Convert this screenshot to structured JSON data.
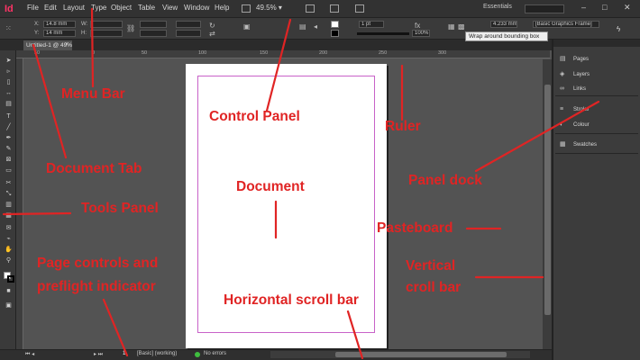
{
  "app": {
    "logo": "Id"
  },
  "menu": [
    "File",
    "Edit",
    "Layout",
    "Type",
    "Object",
    "Table",
    "View",
    "Window",
    "Help"
  ],
  "zoom": "49.5%",
  "workspace": "Essentials",
  "control_panel": {
    "x_label": "X:",
    "x_value": "14.8 mm",
    "y_label": "Y:",
    "y_value": "14 mm",
    "w_label": "W:",
    "h_label": "H:",
    "stroke_weight": "1 pt",
    "scale_value": "100%",
    "offset_value": "4.233 mm",
    "frame_style": "[Basic Graphics Frame]",
    "tooltip": "Wrap around bounding box"
  },
  "document_tab": {
    "label": "Untitled-1 @ 49%",
    "close": "×"
  },
  "ruler_ticks": [
    "50",
    "0",
    "50",
    "100",
    "150",
    "200",
    "250",
    "300"
  ],
  "status_bar": {
    "page": "1",
    "master": "[Basic] (working)",
    "preflight": "No errors"
  },
  "panel_dock": {
    "group1": [
      "Pages",
      "Layers",
      "Links"
    ],
    "group2": [
      "Stroke",
      "Colour"
    ],
    "group3": [
      "Swatches"
    ]
  },
  "annotations": {
    "menu_bar": "Menu Bar",
    "control_panel": "Control Panel",
    "ruler": "Ruler",
    "document_tab": "Document Tab",
    "document": "Document",
    "panel_dock": "Panel dock",
    "tools_panel": "Tools Panel",
    "pasteboard": "Pasteboard",
    "page_controls_1": "Page controls and",
    "page_controls_2": "preflight indicator",
    "vertical_scroll_1": "Vertical",
    "vertical_scroll_2": "croll bar",
    "horizontal_scroll": "Horizontal scroll bar"
  },
  "colors": {
    "annotation": "#e02424",
    "margin_guide": "#c862c8",
    "app_accent": "#ff3366"
  }
}
